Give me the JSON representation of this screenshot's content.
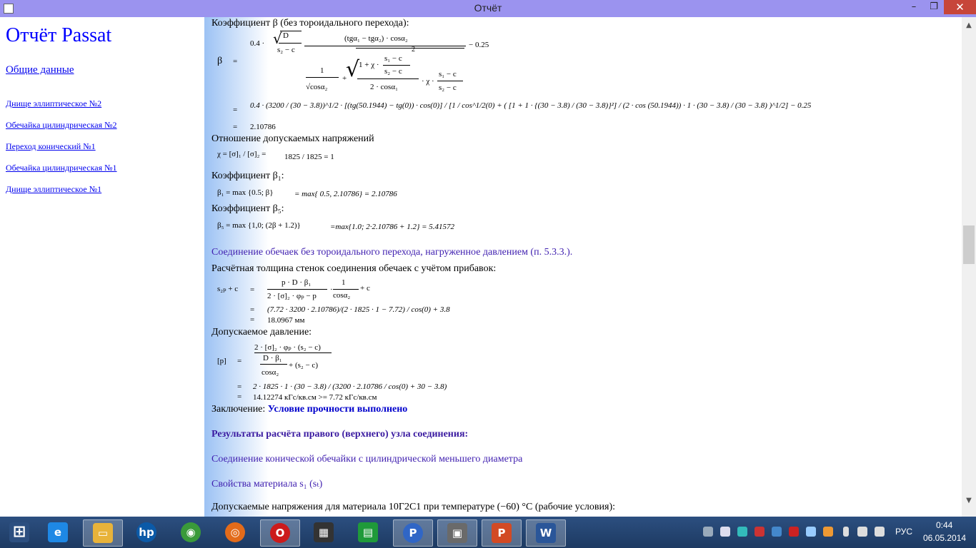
{
  "window": {
    "title": "Отчёт",
    "min_label": "–",
    "max_label": "❐",
    "close_label": "✕"
  },
  "nav": {
    "title": "Отчёт Passat",
    "general": "Общие данные",
    "items": [
      "Днище эллиптическое №2",
      "Обечайка цилиндрическая №2",
      "Переход конический №1",
      "Обечайка цилиндрическая №1",
      "Днище эллиптическое №1"
    ]
  },
  "content": {
    "beta_heading": "Коэффициент β (без тороидального перехода):",
    "beta_symbol": "β",
    "eq": "=",
    "beta_coef": "0.4 ·",
    "beta_D": "D",
    "beta_s2c": "s₂ − c",
    "beta_numerator": "(tgα₁ − tgα₂) · cosα₂",
    "beta_minus": "− 0.25",
    "beta_one": "1",
    "beta_sqrtcos": "√cosα₂",
    "beta_plus": "+",
    "beta_inner": "1 + χ ·",
    "beta_s1c": "s₁ − c",
    "beta_s2c_b": "s₂ − c",
    "beta_sq": "2",
    "beta_2cos": "2 · cosα₁",
    "beta_chi": "· χ ·",
    "beta_s1c_b": "s₁ − c",
    "beta_s2c_c": "s₂ − c",
    "beta_subst": "0.4 · (3200 / (30 − 3.8))^1/2 · [(tg(50.1944) − tg(0)) · cos(0)] / [1 / cos^1/2(0) + ( [1 + 1 · {(30 − 3.8) / (30 − 3.8)}²] / (2 · cos (50.1944)) · 1 · (30 − 3.8) / (30 − 3.8) )^1/2] − 0.25",
    "beta_value": "2.10786",
    "chi_heading": "Отношение допускаемых напряжений",
    "chi_formula": "χ = [σ]₁ / [σ]₂ =",
    "chi_value": "1825 / 1825 = 1",
    "beta1_heading": "Коэффициент β₁:",
    "beta1_formula": "β₁ = max {0.5; β}",
    "beta1_value": "= max{ 0.5, 2.10786} = 2.10786",
    "beta5_heading": "Коэффициент β₅:",
    "beta5_formula": "β₅ = max {1,0;   (2β + 1.2)}",
    "beta5_value": "=max{1.0;  2·2.10786 + 1.2} = 5.41572",
    "section1": "Соединение обечаек без тороидального перехода, нагруженное давлением (п. 5.3.3.).",
    "thick_heading": "Расчётная толщина стенок соединения обечаек с учётом прибавок:",
    "s2p_label": "s₂ₚ + c",
    "s2p_num": "p · D · β₁",
    "s2p_den": "2 · [σ]₂ · φₚ − p",
    "s2p_one": "1",
    "s2p_cos": "cosα₂",
    "s2p_plus": "+ c",
    "s2p_subst": "(7.72 · 3200 · 2.10786)/(2 · 1825 · 1 − 7.72) / cos(0) + 3.8",
    "s2p_value": "18.0967 мм",
    "press_heading": "Допускаемое давление:",
    "p_label": "[p]",
    "p_num": "2 · [σ]₂ · φₚ · (s₂ − c)",
    "p_Db": "D · β₁",
    "p_cos": "cosα₂",
    "p_plus": "+ (s₂ − c)",
    "p_subst": "2 · 1825 · 1 · (30 − 3.8) / (3200 · 2.10786 / cos(0) + 30 − 3.8)",
    "p_value": "14.12274 кГс/кв.см >= 7.72 кГс/кв.см",
    "concl_label": "Заключение:",
    "concl_value": "Условие прочности выполнено",
    "results_heading": "Результаты расчёта правого (верхнего) узла соединения:",
    "section2": "Соединение конической обечайки с цилиндрической меньшего диаметра",
    "material_props": "Свойства материала s₁ (sₜ)",
    "allowed_stress": "Допускаемые напряжения для материала 10Г2С1 при температуре (−60) °С (рабочие условия):"
  },
  "taskbar": {
    "apps": [
      {
        "name": "start",
        "glyph": "⊞",
        "color": "#2c4f80"
      },
      {
        "name": "ie",
        "glyph": "e",
        "color": "#1e88e5"
      },
      {
        "name": "explorer",
        "glyph": "▭",
        "color": "#e8b33a"
      },
      {
        "name": "hp",
        "glyph": "hp",
        "color": "#0b5aa8"
      },
      {
        "name": "chrome",
        "glyph": "◉",
        "color": "#3a9a3a"
      },
      {
        "name": "firefox",
        "glyph": "◎",
        "color": "#e36b1a"
      },
      {
        "name": "opera",
        "glyph": "O",
        "color": "#cc1b1b"
      },
      {
        "name": "app-dark",
        "glyph": "▦",
        "color": "#333333"
      },
      {
        "name": "store",
        "glyph": "▤",
        "color": "#1f9a3a"
      },
      {
        "name": "passat",
        "glyph": "P",
        "color": "#3066c6"
      },
      {
        "name": "report-viewer",
        "glyph": "▣",
        "color": "#6a6a6a"
      },
      {
        "name": "powerpoint",
        "glyph": "P",
        "color": "#d24a24"
      },
      {
        "name": "word",
        "glyph": "W",
        "color": "#2a5699"
      }
    ],
    "lang": "РУС",
    "time": "0:44",
    "date": "06.05.2014"
  }
}
